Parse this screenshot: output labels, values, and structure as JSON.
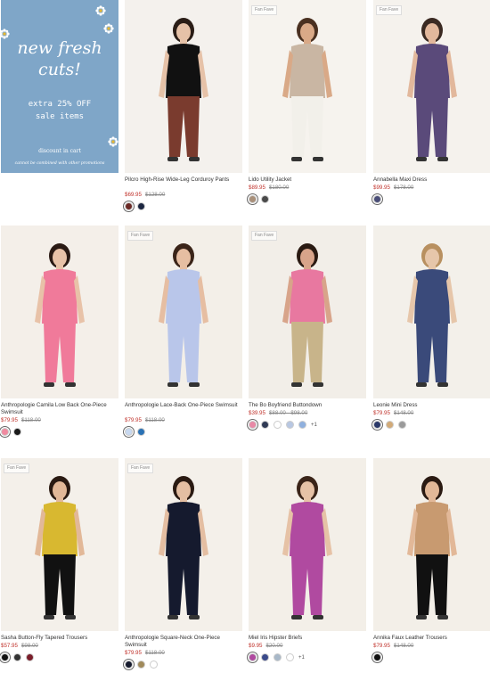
{
  "promo": {
    "title": "new fresh cuts!",
    "offer_line1": "extra 25% OFF",
    "offer_line2": "sale items",
    "note": "discount in cart",
    "fine_print": "cannot be combined with other promotions"
  },
  "badge_label": "Fan Fave",
  "products": [
    {
      "name": "Pilcro High-Rise Wide-Leg Corduroy Pants",
      "price": "$69.95",
      "was": "$128.00",
      "swatches": [
        "#6b2a26",
        "#1c2640"
      ],
      "more": "",
      "badge": false
    },
    {
      "name": "Lido Utility Jacket",
      "price": "$89.95",
      "was": "$180.00",
      "swatches": [
        "#a9907a",
        "#4a4a4a"
      ],
      "more": "",
      "badge": true
    },
    {
      "name": "Annabella Maxi Dress",
      "price": "$99.95",
      "was": "$178.00",
      "swatches": [
        "#4a4e78"
      ],
      "more": "",
      "badge": true
    },
    {
      "name": "Anthropologie Camila Low Back One-Piece Swimsuit",
      "price": "$79.95",
      "was": "$118.00",
      "swatches": [
        "#f08aa0",
        "#1a1a1a"
      ],
      "more": "",
      "badge": false
    },
    {
      "name": "Anthropologie Lace-Back One-Piece Swimsuit",
      "price": "$79.95",
      "was": "$118.00",
      "swatches": [
        "#c7d8f0",
        "#2a72b5"
      ],
      "more": "",
      "badge": true
    },
    {
      "name": "The Bo Boyfriend Buttondown",
      "price": "$39.95",
      "was": "$88.00 - $98.00",
      "swatches": [
        "#e889a6",
        "#2f3a55",
        "#ffffff",
        "#b8c7e2",
        "#8fb0de"
      ],
      "more": "+1",
      "badge": true
    },
    {
      "name": "Leonie Mini Dress",
      "price": "$79.95",
      "was": "$148.00",
      "swatches": [
        "#2a3868",
        "#d2aa78",
        "#9a9a9a"
      ],
      "more": "",
      "badge": false
    },
    {
      "name": "Sasha Button-Fly Tapered Trousers",
      "price": "$57.95",
      "was": "$98.00",
      "swatches": [
        "#111111",
        "#333333",
        "#7a1e2a"
      ],
      "more": "",
      "badge": true
    },
    {
      "name": "Anthropologie Square-Neck One-Piece Swimsuit",
      "price": "$79.95",
      "was": "$118.00",
      "swatches": [
        "#151a2e",
        "#a08a5a",
        "#ffffff"
      ],
      "more": "",
      "badge": true
    },
    {
      "name": "Miel Iris Hipster Briefs",
      "price": "$9.95",
      "was": "$20.00",
      "swatches": [
        "#b04aa0",
        "#3a4a8a",
        "#a8b8c8",
        "#ffffff"
      ],
      "more": "+1",
      "badge": false
    },
    {
      "name": "Annika Faux Leather Trousers",
      "price": "$79.95",
      "was": "$148.00",
      "swatches": [
        "#111111"
      ],
      "more": "",
      "badge": false
    }
  ]
}
